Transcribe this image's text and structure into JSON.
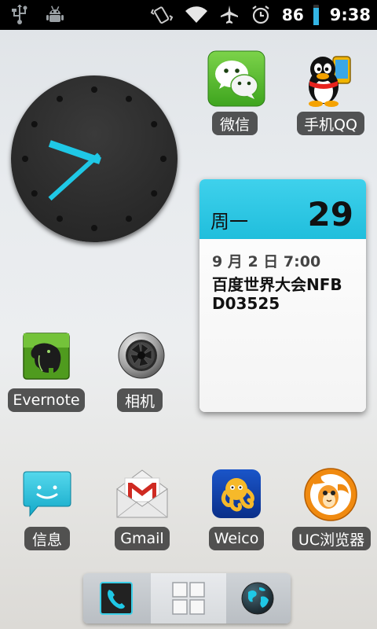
{
  "status_bar": {
    "icons": [
      "usb-icon",
      "android-debug-icon",
      "vibrate-icon",
      "wifi-icon",
      "airplane-icon",
      "alarm-icon"
    ],
    "battery_percent": "86",
    "battery_level": 0.86,
    "time": "9:38",
    "accent_color": "#33b5e5"
  },
  "clock_widget": {
    "hour": 9,
    "minute": 38,
    "hand_color": "#1fc8e6"
  },
  "apps": {
    "wechat": "微信",
    "qq": "手机QQ",
    "evernote": "Evernote",
    "camera": "相机",
    "messages": "信息",
    "gmail": "Gmail",
    "weico": "Weico",
    "uc_browser": "UC浏览器"
  },
  "calendar_widget": {
    "weekday": "周一",
    "date": "29",
    "event_time": "9 月 2 日 7:00",
    "event_title": "百度世界大会NFBD03525"
  },
  "dock": {
    "items": [
      "phone-icon",
      "all-apps-icon",
      "browser-globe-icon"
    ]
  }
}
